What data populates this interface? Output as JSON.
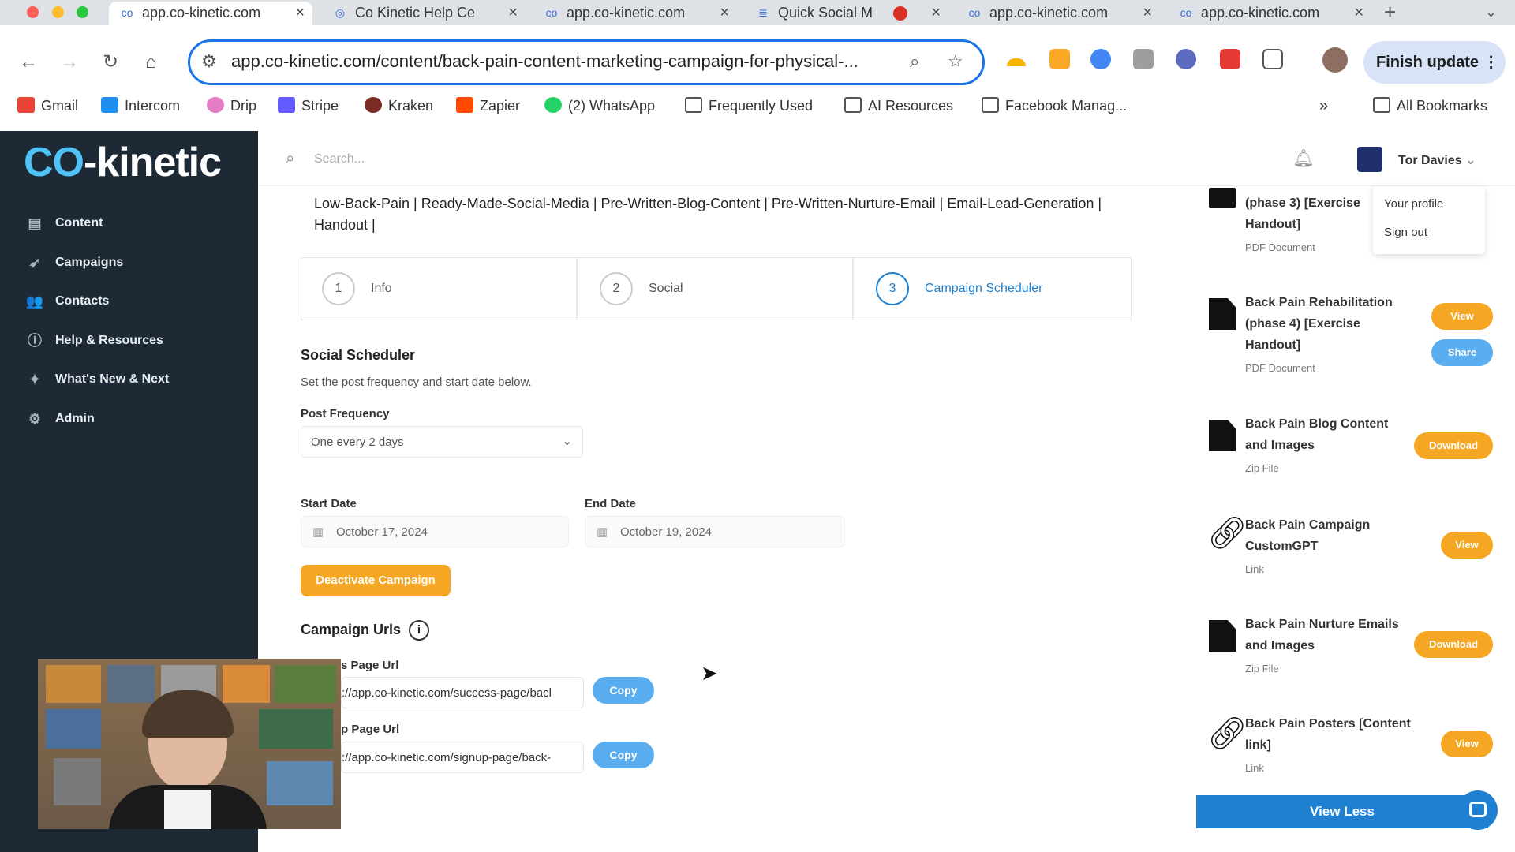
{
  "browser": {
    "tabs": [
      {
        "title": "app.co-kinetic.com"
      },
      {
        "title": "Co Kinetic Help Ce"
      },
      {
        "title": "app.co-kinetic.com"
      },
      {
        "title": "Quick Social M"
      },
      {
        "title": "app.co-kinetic.com"
      },
      {
        "title": "app.co-kinetic.com"
      }
    ],
    "url": "app.co-kinetic.com/content/back-pain-content-marketing-campaign-for-physical-...",
    "finish_update": "Finish update",
    "bookmarks": [
      "Gmail",
      "Intercom",
      "Drip",
      "Stripe",
      "Kraken",
      "Zapier",
      "(2) WhatsApp",
      "Frequently Used",
      "AI Resources",
      "Facebook Manag..."
    ],
    "all_bookmarks": "All Bookmarks",
    "overflow": "»"
  },
  "app": {
    "logo_co": "CO",
    "logo_rest": "-kinetic",
    "search_placeholder": "Search...",
    "user_name": "Tor Davies",
    "user_menu": {
      "profile": "Your profile",
      "signout": "Sign out"
    },
    "nav": [
      {
        "label": "Content",
        "icon": "document-icon"
      },
      {
        "label": "Campaigns",
        "icon": "rocket-icon"
      },
      {
        "label": "Contacts",
        "icon": "users-icon"
      },
      {
        "label": "Help & Resources",
        "icon": "info-icon"
      },
      {
        "label": "What's New & Next",
        "icon": "sparkle-icon"
      },
      {
        "label": "Admin",
        "icon": "gear-icon"
      }
    ]
  },
  "main": {
    "tags_line1": "Low-Back-Pain | Ready-Made-Social-Media | Pre-Written-Blog-Content | Pre-Written-Nurture-Email | Email-Lead-Generation |",
    "tags_line2": "Handout |",
    "steps": [
      {
        "num": "1",
        "label": "Info"
      },
      {
        "num": "2",
        "label": "Social"
      },
      {
        "num": "3",
        "label": "Campaign Scheduler"
      }
    ],
    "scheduler_title": "Social Scheduler",
    "scheduler_desc": "Set the post frequency and start date below.",
    "frequency_label": "Post Frequency",
    "frequency_value": "One every 2 days",
    "start_label": "Start Date",
    "start_value": "October 17, 2024",
    "end_label": "End Date",
    "end_value": "October 19, 2024",
    "deactivate": "Deactivate Campaign",
    "urls_title": "Campaign Urls",
    "success_label": "s Page Url",
    "success_value": "://app.co-kinetic.com/success-page/bacl",
    "signup_label": "p Page Url",
    "signup_value": "://app.co-kinetic.com/signup-page/back-",
    "copy": "Copy"
  },
  "resources": [
    {
      "title": "(phase 3) [Exercise Handout]",
      "type": "PDF Document",
      "icon": "pdf-file-icon"
    },
    {
      "title": "Back Pain Rehabilitation (phase 4) [Exercise Handout]",
      "type": "PDF Document",
      "icon": "pdf-file-icon",
      "btn1": "View",
      "btn2": "Share"
    },
    {
      "title": "Back Pain Blog Content and Images",
      "type": "Zip File",
      "icon": "download-file-icon",
      "btn1": "Download"
    },
    {
      "title": "Back Pain Campaign CustomGPT",
      "type": "Link",
      "icon": "link-icon",
      "btn1": "View"
    },
    {
      "title": "Back Pain Nurture Emails and Images",
      "type": "Zip File",
      "icon": "download-file-icon",
      "btn1": "Download"
    },
    {
      "title": "Back Pain Posters [Content link]",
      "type": "Link",
      "icon": "link-icon",
      "btn1": "View"
    }
  ],
  "view_less": "View Less",
  "colors": {
    "accent_orange": "#f5a623",
    "accent_blue": "#1f7fd1",
    "sidebar": "#1d2a35"
  }
}
